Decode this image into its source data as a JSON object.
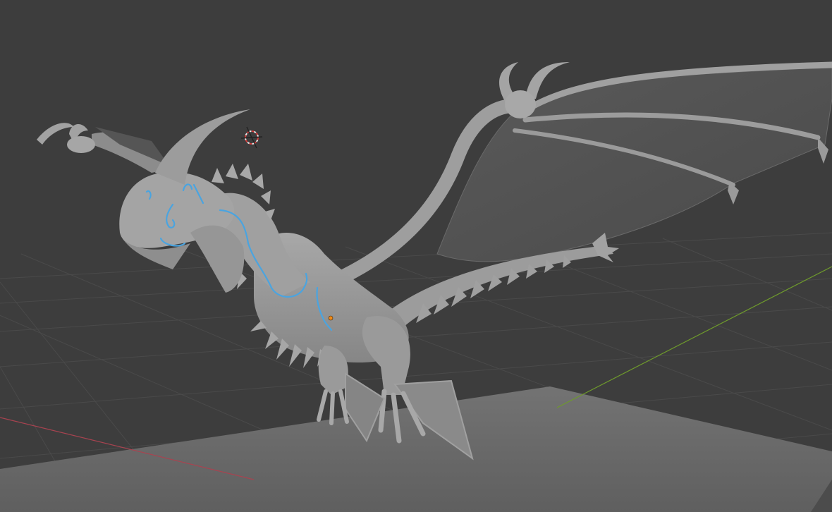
{
  "app": {
    "name": "3D viewport",
    "mode": "object"
  },
  "viewport": {
    "background_color": "#3d3d3d",
    "grid_color": "#4a4a4a",
    "x_axis_color": "#a84350",
    "y_axis_color": "#6e9a2c",
    "floor_color": "#6e6e6e",
    "model_color": "#9a9a9a",
    "model_shadow_color": "#7c7c7c",
    "grease_pencil_color": "#4aa4e0",
    "origin_color": "#f08a18",
    "cursor_color": "#d23a3a"
  },
  "scene": {
    "object": "dragon-model",
    "annotation": "grease-pencil-strokes",
    "cursor": "3d-cursor-icon",
    "origin": "object-origin-icon"
  }
}
